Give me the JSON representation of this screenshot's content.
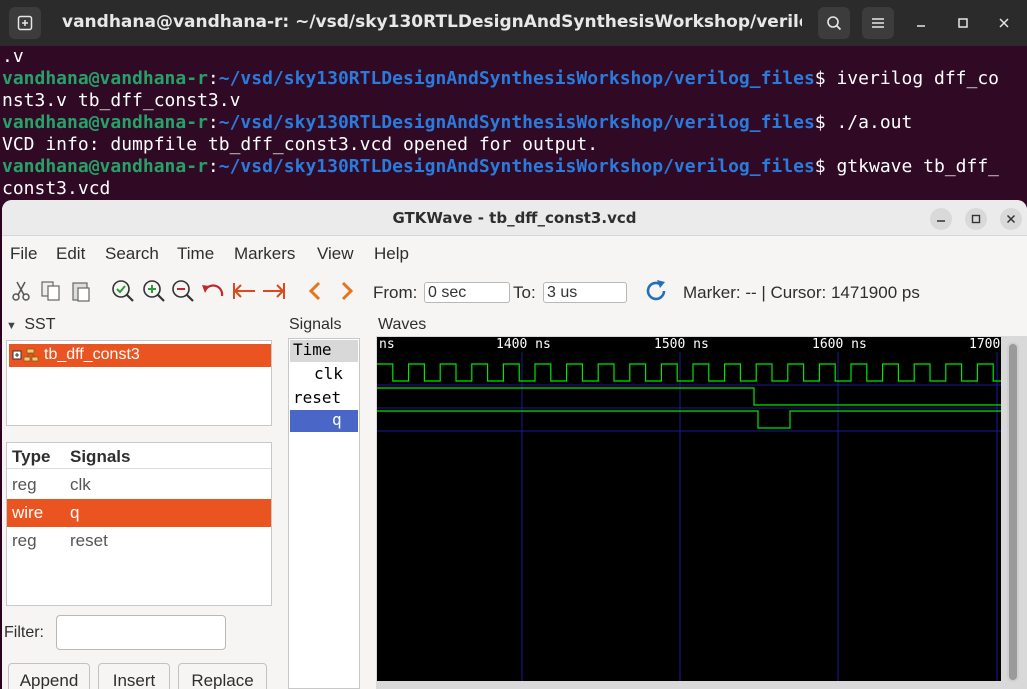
{
  "terminal": {
    "title": "vandhana@vandhana-r: ~/vsd/sky130RTLDesignAndSynthesisWorkshop/verilog_fi...",
    "prompt_user": "vandhana@vandhana-r",
    "prompt_path": "~/vsd/sky130RTLDesignAndSynthesisWorkshop/verilog_files",
    "lines": [
      {
        "text": ".v"
      },
      {
        "cmd": "iverilog dff_co"
      },
      {
        "text": "nst3.v tb_dff_const3.v"
      },
      {
        "cmd": "./a.out"
      },
      {
        "text": "VCD info: dumpfile tb_dff_const3.vcd opened for output."
      },
      {
        "cmd": "gtkwave tb_dff_"
      },
      {
        "text": "const3.vcd"
      }
    ]
  },
  "gtkwave": {
    "title": "GTKWave - tb_dff_const3.vcd",
    "menu": [
      "File",
      "Edit",
      "Search",
      "Time",
      "Markers",
      "View",
      "Help"
    ],
    "toolbar": {
      "from_label": "From:",
      "from_value": "0 sec",
      "to_label": "To:",
      "to_value": "3 us",
      "marker_text": "Marker: --  |  Cursor: 1471900 ps"
    },
    "sst": {
      "header": "SST",
      "tree_item": "tb_dff_const3"
    },
    "signal_table": {
      "headers": [
        "Type",
        "Signals"
      ],
      "rows": [
        {
          "type": "reg",
          "name": "clk",
          "selected": false
        },
        {
          "type": "wire",
          "name": "q",
          "selected": true
        },
        {
          "type": "reg",
          "name": "reset",
          "selected": false
        }
      ]
    },
    "filter_label": "Filter:",
    "buttons": [
      "Append",
      "Insert",
      "Replace"
    ],
    "signals_pane": {
      "label": "Signals",
      "items": [
        "Time",
        "clk",
        "reset",
        "q"
      ]
    },
    "waves": {
      "label": "Waves",
      "time_labels": [
        "ns",
        "1400 ns",
        "1500 ns",
        "1600 ns",
        "1700"
      ],
      "wave_color": "#00e600"
    }
  }
}
